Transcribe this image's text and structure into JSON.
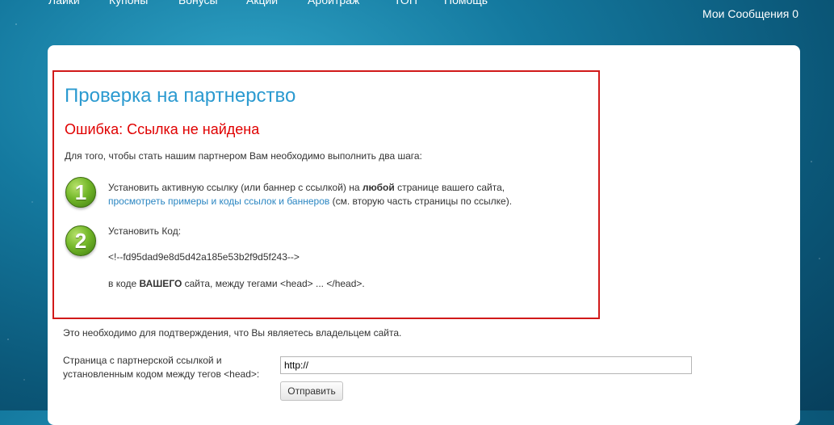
{
  "nav": {
    "items": [
      "Лайки",
      "Купоны",
      "Бонусы",
      "Акции",
      "Арбитраж",
      "ТОП",
      "Помощь"
    ],
    "messages_label": "Мои Сообщения 0"
  },
  "card": {
    "title": "Проверка на партнерство",
    "error": "Ошибка: Ссылка не найдена",
    "intro": "Для того, чтобы стать нашим партнером Вам необходимо выполнить два шага:",
    "step1": {
      "number": "1",
      "text_before": "Установить активную ссылку (или баннер с ссылкой) на ",
      "bold": "любой",
      "text_after": " странице вашего сайта,",
      "link": "просмотреть примеры и коды ссылок и баннеров",
      "link_after": " (см. вторую часть страницы по ссылке)."
    },
    "step2": {
      "number": "2",
      "label": "Установить Код:",
      "code": "<!--fd95dad9e8d5d42a185e53b2f9d5f243-->",
      "note_before": "в коде ",
      "note_bold": "ВАШЕГО",
      "note_after": " сайта, между тегами <head> ... </head>."
    }
  },
  "confirm_text": "Это необходимо для подтверждения, что Вы являетесь владельцем сайта.",
  "form": {
    "label_line1": "Страница с партнерской ссылкой и",
    "label_line2": "установленным кодом между тегов <head>:",
    "url_value": "http://",
    "submit_label": "Отправить"
  }
}
